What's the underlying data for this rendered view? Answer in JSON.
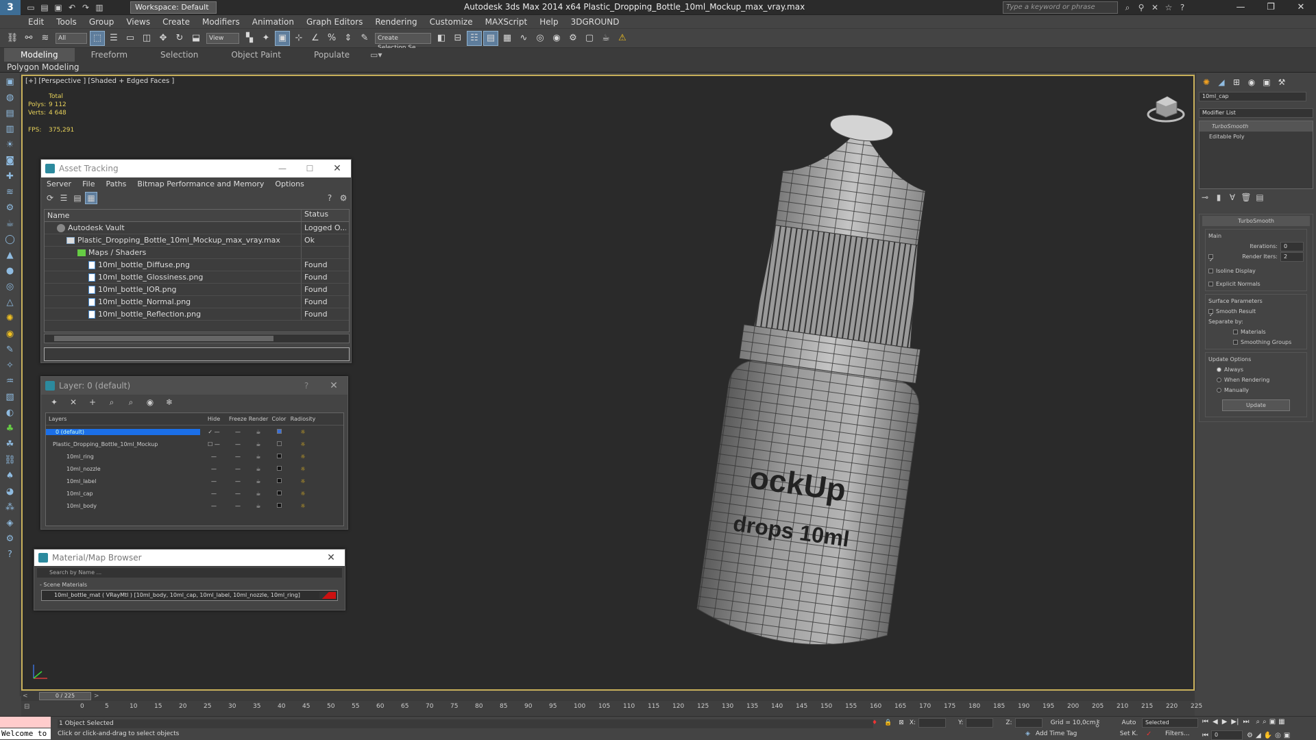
{
  "titlebar": {
    "workspace": "Workspace: Default",
    "title": "Autodesk 3ds Max  2014 x64      Plastic_Dropping_Bottle_10ml_Mockup_max_vray.max",
    "search_placeholder": "Type a keyword or phrase",
    "logo": "3"
  },
  "menu": [
    "Edit",
    "Tools",
    "Group",
    "Views",
    "Create",
    "Modifiers",
    "Animation",
    "Graph Editors",
    "Rendering",
    "Customize",
    "MAXScript",
    "Help",
    "3DGROUND"
  ],
  "toolbar": {
    "filter": "All",
    "refcoord": "View",
    "selset": "Create Selection Se"
  },
  "ribbon": {
    "tabs": [
      "Modeling",
      "Freeform",
      "Selection",
      "Object Paint",
      "Populate"
    ],
    "sub": "Polygon Modeling"
  },
  "viewport": {
    "label": "[+] [Perspective ] [Shaded + Edged Faces ]",
    "stats": {
      "total": "Total",
      "polys_label": "Polys:",
      "polys": "9 112",
      "verts_label": "Verts:",
      "verts": "4 648"
    },
    "fps_label": "FPS:",
    "fps": "375,291",
    "label_text_1": "ockUp",
    "label_text_2": "drops 10ml"
  },
  "asset": {
    "title": "Asset Tracking",
    "menu": [
      "Server",
      "File",
      "Paths",
      "Bitmap Performance and Memory",
      "Options"
    ],
    "col_name": "Name",
    "col_status": "Status",
    "rows": [
      {
        "name": "Autodesk Vault",
        "status": "Logged O..."
      },
      {
        "name": "Plastic_Dropping_Bottle_10ml_Mockup_max_vray.max",
        "status": "Ok"
      },
      {
        "name": "Maps / Shaders",
        "status": ""
      },
      {
        "name": "10ml_bottle_Diffuse.png",
        "status": "Found"
      },
      {
        "name": "10ml_bottle_Glossiness.png",
        "status": "Found"
      },
      {
        "name": "10ml_bottle_IOR.png",
        "status": "Found"
      },
      {
        "name": "10ml_bottle_Normal.png",
        "status": "Found"
      },
      {
        "name": "10ml_bottle_Reflection.png",
        "status": "Found"
      }
    ]
  },
  "layer": {
    "title": "Layer: 0 (default)",
    "help": "?",
    "cols": [
      "Layers",
      "Hide",
      "Freeze",
      "Render",
      "Color",
      "Radiosity"
    ],
    "rows": [
      {
        "name": "0 (default)",
        "color": "#3a6fd8"
      },
      {
        "name": "Plastic_Dropping_Bottle_10ml_Mockup",
        "color": "#333333"
      },
      {
        "name": "10ml_ring",
        "color": "#111111"
      },
      {
        "name": "10ml_nozzle",
        "color": "#111111"
      },
      {
        "name": "10ml_label",
        "color": "#111111"
      },
      {
        "name": "10ml_cap",
        "color": "#111111"
      },
      {
        "name": "10ml_body",
        "color": "#111111"
      }
    ]
  },
  "matbrowser": {
    "title": "Material/Map Browser",
    "search": "Search by Name ...",
    "section": "- Scene Materials",
    "item": "10ml_bottle_mat  ( VRayMtl ) [10ml_body, 10ml_cap, 10ml_label, 10ml_nozzle, 10ml_ring]"
  },
  "cmd": {
    "object_name": "10ml_cap",
    "modifier_list": "Modifier List",
    "stack": [
      "TurboSmooth",
      "Editable Poly"
    ],
    "rollout": "TurboSmooth",
    "main": "Main",
    "iterations_label": "Iterations:",
    "iterations": "0",
    "render_iters_label": "Render Iters:",
    "render_iters": "2",
    "isoline": "Isoline Display",
    "explicit": "Explicit Normals",
    "surface": "Surface Parameters",
    "smooth_result": "Smooth Result",
    "separate": "Separate by:",
    "materials": "Materials",
    "smoothing": "Smoothing Groups",
    "update_opts": "Update Options",
    "always": "Always",
    "when_rendering": "When Rendering",
    "manually": "Manually",
    "update_btn": "Update"
  },
  "timeline": {
    "frame": "0 / 225",
    "ticks": [
      "0",
      "5",
      "10",
      "15",
      "20",
      "25",
      "30",
      "35",
      "40",
      "45",
      "50",
      "55",
      "60",
      "65",
      "70",
      "75",
      "80",
      "85",
      "90",
      "95",
      "100",
      "105",
      "110",
      "115",
      "120",
      "125",
      "130",
      "135",
      "140",
      "145",
      "150",
      "155",
      "160",
      "165",
      "170",
      "175",
      "180",
      "185",
      "190",
      "195",
      "200",
      "205",
      "210",
      "215",
      "220",
      "225"
    ]
  },
  "status": {
    "welcome": "Welcome to",
    "selected": "1 Object Selected",
    "prompt": "Click or click-and-drag to select objects",
    "x": "X:",
    "y": "Y:",
    "z": "Z:",
    "grid": "Grid = 10,0cm",
    "add_tag": "Add Time Tag",
    "auto": "Auto",
    "selected_dd": "Selected",
    "setk": "Set K.",
    "filters": "Filters...",
    "frame_field": "0"
  },
  "colors": {
    "viewport_border": "#c8b05a",
    "accent": "#5e7d9c"
  }
}
